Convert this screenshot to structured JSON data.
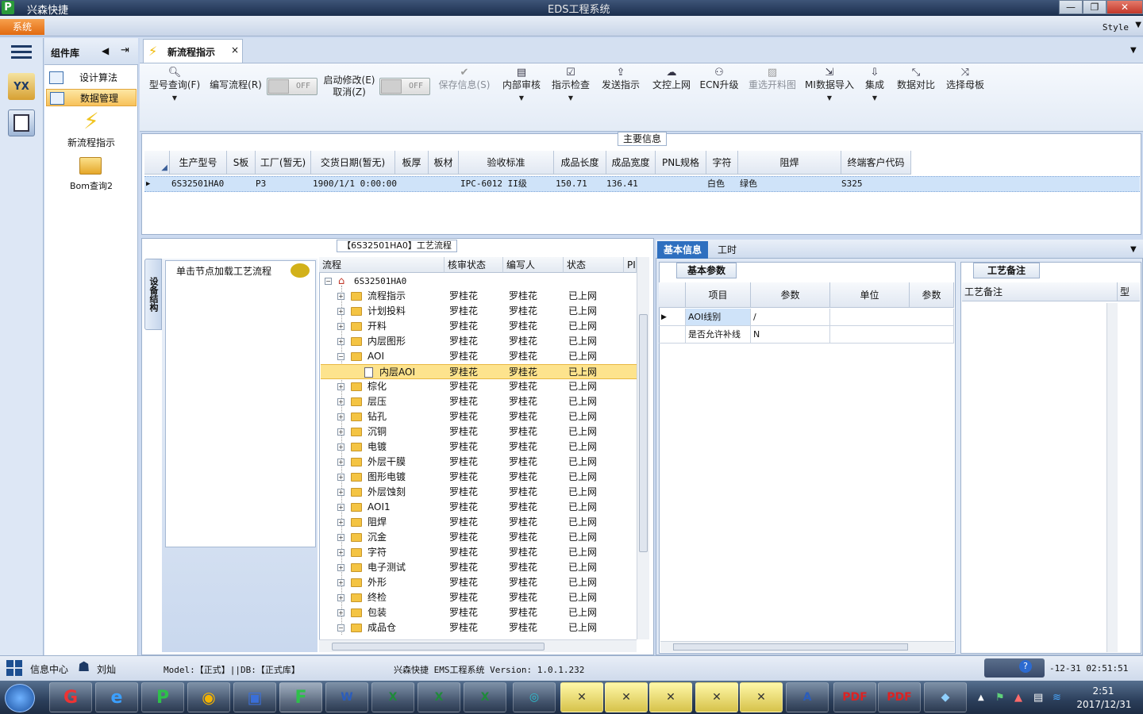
{
  "titlebar": {
    "app_logo": "P",
    "app_name": "兴森快捷",
    "window_title": "EDS工程系统",
    "minimize": "—",
    "maximize": "❐",
    "close": "✕"
  },
  "menu": {
    "system": "系统",
    "style": "Style",
    "arrow": "▼"
  },
  "component_panel": {
    "title": "组件库",
    "items": [
      {
        "label": "设计算法"
      },
      {
        "label": "数据管理"
      }
    ],
    "quick": [
      {
        "label": "新流程指示"
      },
      {
        "label": "Bom查询2"
      }
    ]
  },
  "doc_tab": {
    "label": "新流程指示",
    "close": "×",
    "dropdown": "▼"
  },
  "toolbar": {
    "model_query": "型号查询(F)",
    "write_flow": "编写流程(R)",
    "toggle1": "OFF",
    "start_modify": "启动修改(E)",
    "cancel": "取消(Z)",
    "toggle2": "OFF",
    "save_info": "保存信息(S)",
    "internal_audit": "内部审核",
    "instruction_check": "指示检查",
    "send_instruction": "发送指示",
    "file_upload": "文控上网",
    "ecn_upgrade": "ECN升级",
    "redraw_cut": "重选开料图",
    "mi_import": "MI数据导入",
    "integrate": "集成",
    "data_compare": "数据对比",
    "select_mother": "选择母板"
  },
  "main_info": {
    "title": "主要信息",
    "columns": [
      "生产型号",
      "S板",
      "工厂(暂无)",
      "交货日期(暂无)",
      "板厚",
      "板材",
      "验收标准",
      "成品长度",
      "成品宽度",
      "PNL规格",
      "字符",
      "阻焊",
      "终端客户代码"
    ],
    "row": {
      "model": "6S32501HA0",
      "factory": "P3",
      "date": "1900/1/1 0:00:00",
      "standard": "IPC-6012 II级",
      "length": "150.71",
      "width": "136.41",
      "char": "白色",
      "mask": "绿色",
      "customer": "S325"
    }
  },
  "flow_panel": {
    "title": "【6S32501HA0】工艺流程",
    "side_tab": "设备结构",
    "load_hint": "单击节点加载工艺流程",
    "columns": [
      "流程",
      "核审状态",
      "编写人",
      "状态",
      "PI"
    ],
    "root": "6S32501HA0",
    "rows": [
      {
        "name": "流程指示",
        "audit": "罗桂花",
        "writer": "罗桂花",
        "status": "已上网"
      },
      {
        "name": "计划投料",
        "audit": "罗桂花",
        "writer": "罗桂花",
        "status": "已上网"
      },
      {
        "name": "开料",
        "audit": "罗桂花",
        "writer": "罗桂花",
        "status": "已上网"
      },
      {
        "name": "内层图形",
        "audit": "罗桂花",
        "writer": "罗桂花",
        "status": "已上网"
      },
      {
        "name": "AOI",
        "audit": "罗桂花",
        "writer": "罗桂花",
        "status": "已上网"
      },
      {
        "name": "内层AOI",
        "audit": "罗桂花",
        "writer": "罗桂花",
        "status": "已上网"
      },
      {
        "name": "棕化",
        "audit": "罗桂花",
        "writer": "罗桂花",
        "status": "已上网"
      },
      {
        "name": "层压",
        "audit": "罗桂花",
        "writer": "罗桂花",
        "status": "已上网"
      },
      {
        "name": "钻孔",
        "audit": "罗桂花",
        "writer": "罗桂花",
        "status": "已上网"
      },
      {
        "name": "沉铜",
        "audit": "罗桂花",
        "writer": "罗桂花",
        "status": "已上网"
      },
      {
        "name": "电镀",
        "audit": "罗桂花",
        "writer": "罗桂花",
        "status": "已上网"
      },
      {
        "name": "外层干膜",
        "audit": "罗桂花",
        "writer": "罗桂花",
        "status": "已上网"
      },
      {
        "name": "图形电镀",
        "audit": "罗桂花",
        "writer": "罗桂花",
        "status": "已上网"
      },
      {
        "name": "外层蚀刻",
        "audit": "罗桂花",
        "writer": "罗桂花",
        "status": "已上网"
      },
      {
        "name": "AOI1",
        "audit": "罗桂花",
        "writer": "罗桂花",
        "status": "已上网"
      },
      {
        "name": "阻焊",
        "audit": "罗桂花",
        "writer": "罗桂花",
        "status": "已上网"
      },
      {
        "name": "沉金",
        "audit": "罗桂花",
        "writer": "罗桂花",
        "status": "已上网"
      },
      {
        "name": "字符",
        "audit": "罗桂花",
        "writer": "罗桂花",
        "status": "已上网"
      },
      {
        "name": "电子测试",
        "audit": "罗桂花",
        "writer": "罗桂花",
        "status": "已上网"
      },
      {
        "name": "外形",
        "audit": "罗桂花",
        "writer": "罗桂花",
        "status": "已上网"
      },
      {
        "name": "终检",
        "audit": "罗桂花",
        "writer": "罗桂花",
        "status": "已上网"
      },
      {
        "name": "包装",
        "audit": "罗桂花",
        "writer": "罗桂花",
        "status": "已上网"
      },
      {
        "name": "成品仓",
        "audit": "罗桂花",
        "writer": "罗桂花",
        "status": "已上网"
      }
    ]
  },
  "right_panel": {
    "tabs": [
      "基本信息",
      "工时"
    ],
    "params_title": "基本参数",
    "notes_title": "工艺备注",
    "params_columns": [
      "项目",
      "参数",
      "单位",
      "参数"
    ],
    "params_rows": [
      {
        "item": "AOI线别",
        "value": "/"
      },
      {
        "item": "是否允许补线",
        "value": "N"
      }
    ],
    "notes_columns": [
      "工艺备注",
      "型"
    ]
  },
  "statusbar": {
    "info_center": "信息中心",
    "user": "刘灿",
    "model": "Model:【正式】||DB:【正式库】",
    "version": "兴森快捷 EMS工程系统 Version: 1.0.1.232",
    "clock": "-12-31 02:51:51"
  },
  "taskbar": {
    "time": "2:51",
    "date": "2017/12/31"
  }
}
